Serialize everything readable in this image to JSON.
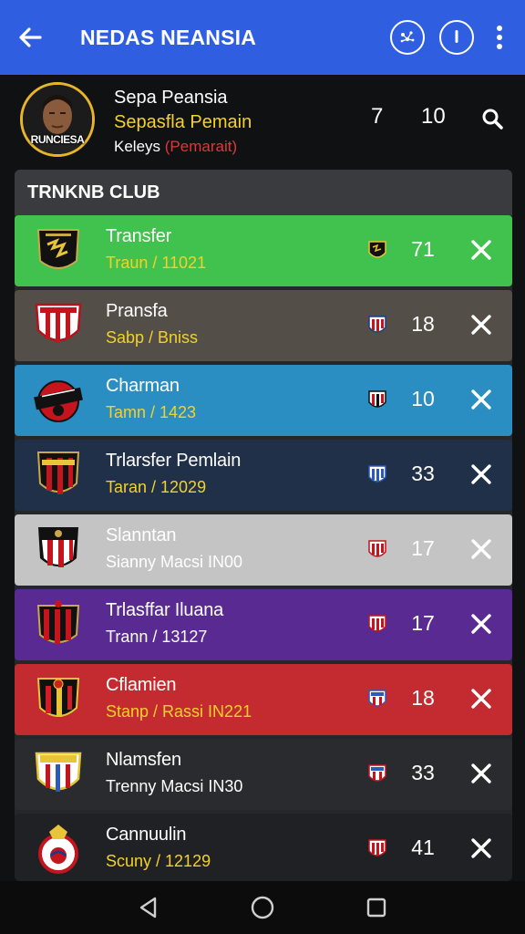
{
  "appbar": {
    "title": "NEDAS NEANSIA",
    "icons": [
      "back-arrow-icon",
      "team-crest-icon",
      "info-icon",
      "more-vert-icon"
    ]
  },
  "player": {
    "name": "Sepa Peansia",
    "subtitle": "Sepasfla Pemain",
    "team_prefix": "Keleys",
    "team_suffix": "(Pemarait)",
    "avatar_caption": "RUNCIESA",
    "stat1": "7",
    "stat2": "10"
  },
  "panel": {
    "title": "TRNKNB CLUB"
  },
  "rows": [
    {
      "name": "Transfer",
      "sub": "Traun / 11021",
      "num": "71"
    },
    {
      "name": "Pransfa",
      "sub": "Sabp / Bniss",
      "num": "18"
    },
    {
      "name": "Charman",
      "sub": "Tamn / 1423",
      "num": "10"
    },
    {
      "name": "Trlarsfer Pemlain",
      "sub": "Taran / 12029",
      "num": "33"
    },
    {
      "name": "Slanntan",
      "sub": "Sianny Macsi IN00",
      "num": "17"
    },
    {
      "name": "Trlasffar Iluana",
      "sub": "Trann / 13127",
      "num": "17"
    },
    {
      "name": "Cflamien",
      "sub": "Stanp / Rassi IN221",
      "num": "18"
    },
    {
      "name": "Nlamsfen",
      "sub": "Trenny Macsi IN30",
      "num": "33"
    },
    {
      "name": "Cannuulin",
      "sub": "Scuny / 12129",
      "num": "41"
    }
  ],
  "colors": {
    "appbar": "#2f5fe0",
    "row_backgrounds": [
      "#41c14d",
      "#534e47",
      "#2b8ec3",
      "#1f3048",
      "#c4c4c4",
      "#5a2a93",
      "#c42b30",
      "#2a2b2f",
      "#202124"
    ],
    "highlight_yellow": "#f2d22a",
    "accent_red": "#e0363a"
  },
  "navbar": {
    "icons": [
      "nav-back-icon",
      "nav-home-icon",
      "nav-recents-icon"
    ]
  }
}
